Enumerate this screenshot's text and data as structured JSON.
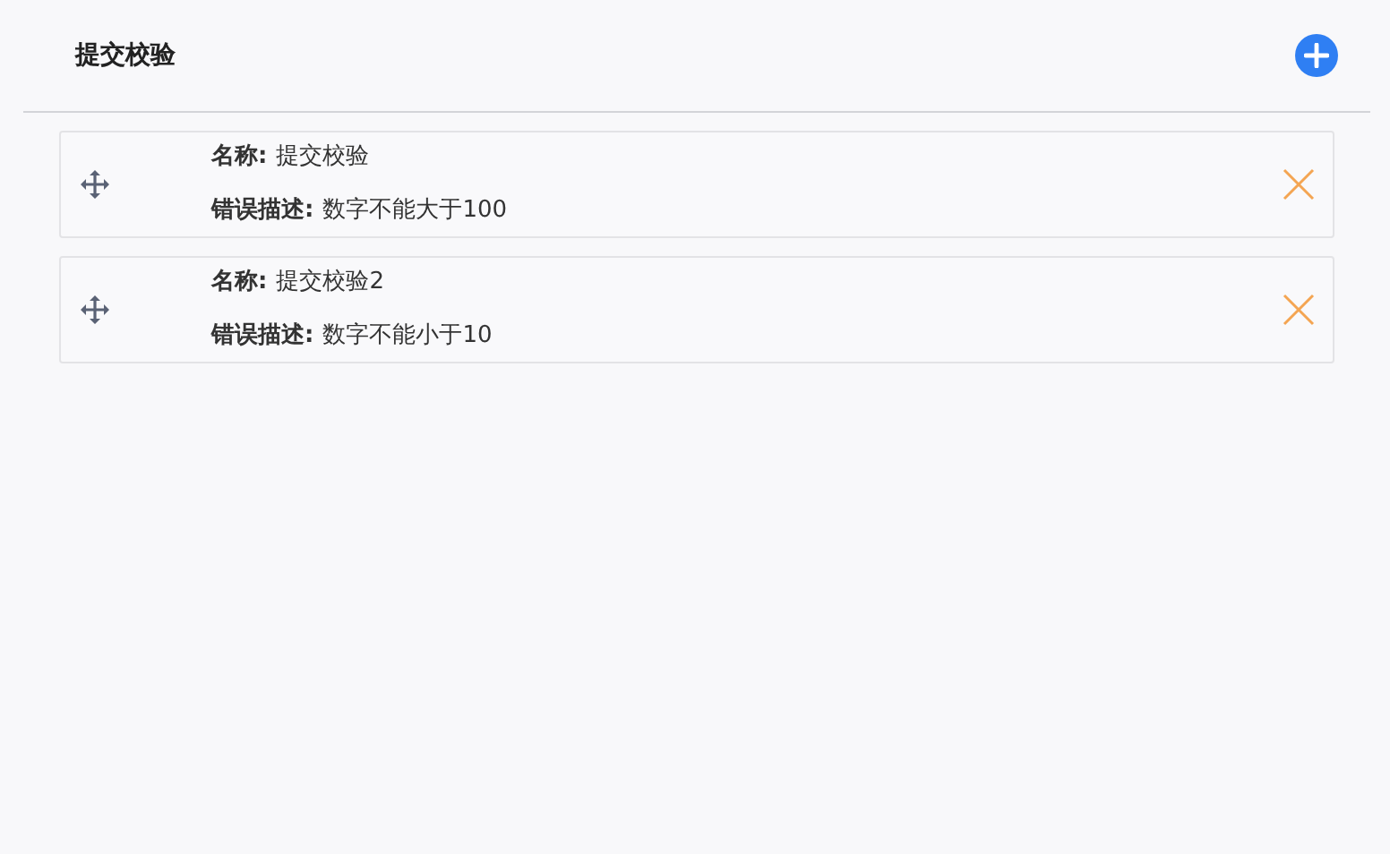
{
  "header": {
    "title": "提交校验"
  },
  "rules": [
    {
      "name_label": "名称:",
      "name": "提交校验",
      "desc_label": "错误描述:",
      "desc": "数字不能大于100"
    },
    {
      "name_label": "名称:",
      "name": "提交校验2",
      "desc_label": "错误描述:",
      "desc": "数字不能小于10"
    }
  ]
}
